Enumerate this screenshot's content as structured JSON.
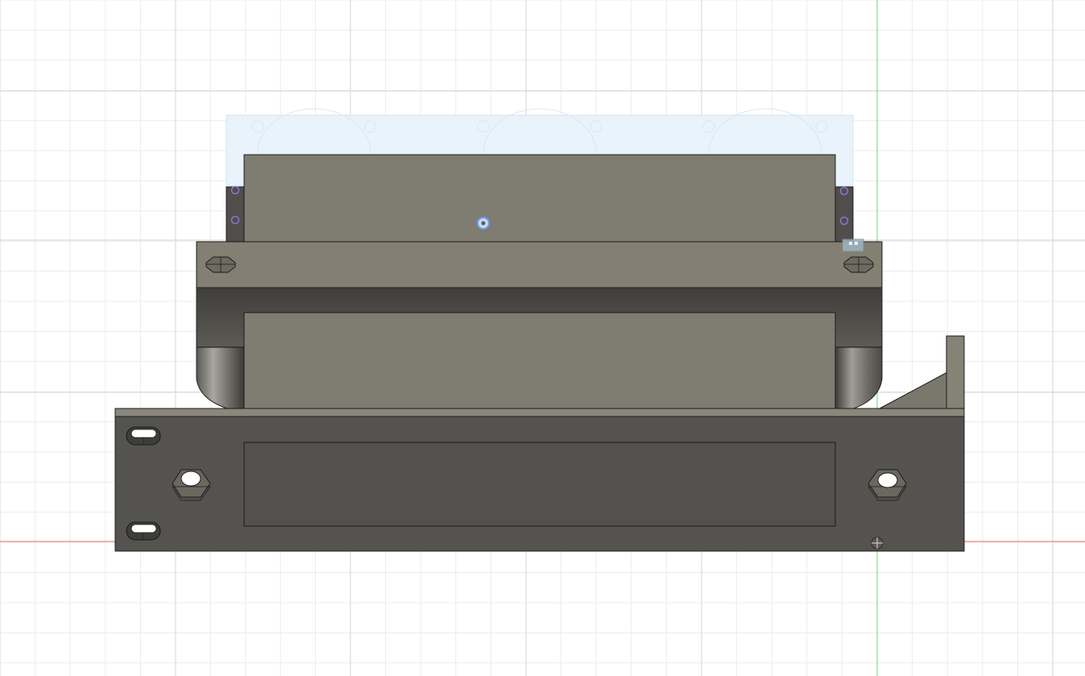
{
  "viewport": {
    "background": "#ffffff",
    "colors": {
      "grid_minor": "#ececec",
      "grid_major": "#d6d6d6",
      "x_axis": "#e36a6a",
      "y_axis": "#6fd36f",
      "body_face_light": "#7f7c71",
      "body_face_mid": "#5f5d56",
      "body_face_dark": "#4f4e4a",
      "body_top_strip": "#8a877c",
      "edge": "#1b1b1b",
      "selection_tint": "#e8f3fb",
      "point_marker": "#8f74d8",
      "origin_marker": "#6aa0e8"
    },
    "icons": {
      "origin": "origin-crosshair-icon",
      "sketch_point": "sketch-point-icon",
      "center_point": "center-point-icon",
      "view_cube_hint": "mini-widget-icon"
    }
  }
}
